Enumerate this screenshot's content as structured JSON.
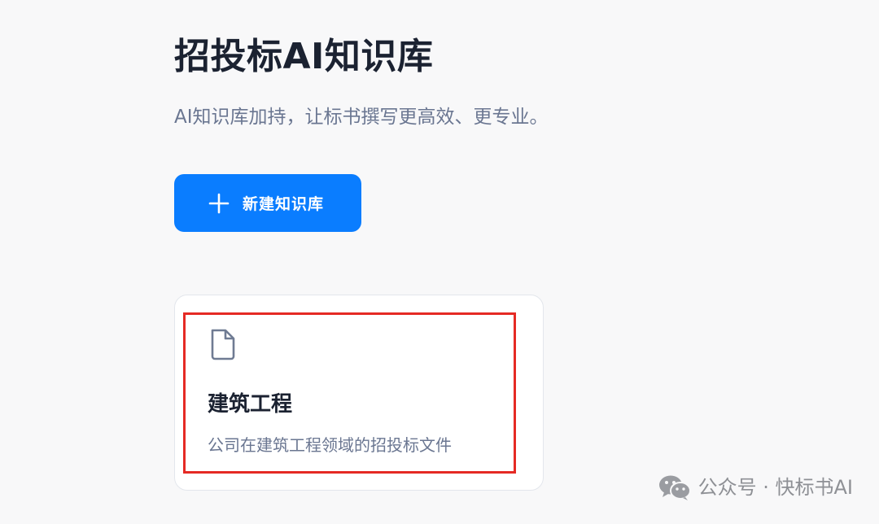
{
  "header": {
    "title": "招投标AI知识库",
    "subtitle": "AI知识库加持，让标书撰写更高效、更专业。"
  },
  "actions": {
    "new_button_label": "新建知识库",
    "new_button_icon": "plus-icon"
  },
  "knowledge_bases": [
    {
      "icon": "file-icon",
      "title": "建筑工程",
      "description": "公司在建筑工程领域的招投标文件"
    }
  ],
  "watermark": {
    "icon": "wechat-icon",
    "text": "公众号 · 快标书AI"
  },
  "colors": {
    "accent": "#0a7dff",
    "highlight_border": "#e52a24",
    "title_text": "#1b2231",
    "muted_text": "#6a7691",
    "background": "#f8f8f9"
  }
}
